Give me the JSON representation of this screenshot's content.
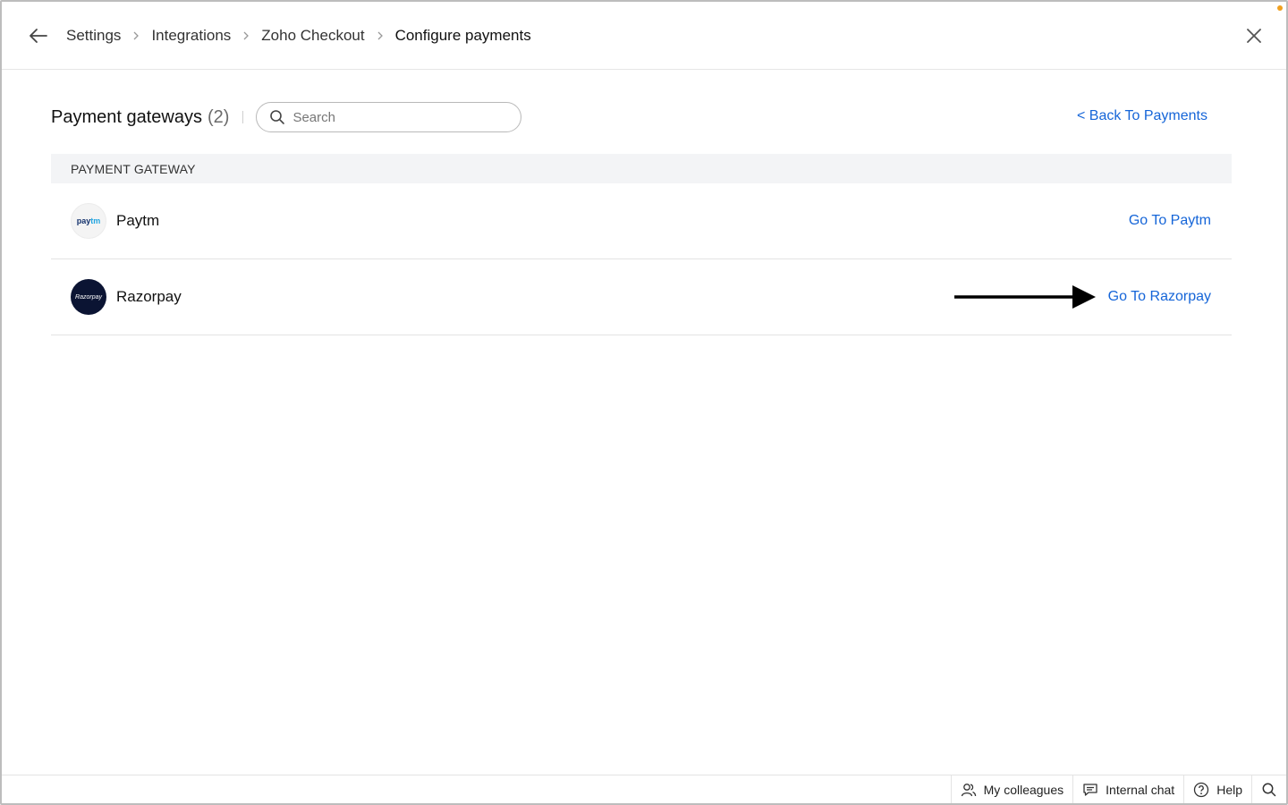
{
  "breadcrumb": [
    "Settings",
    "Integrations",
    "Zoho Checkout",
    "Configure payments"
  ],
  "title": {
    "label": "Payment gateways",
    "count": "(2)"
  },
  "search": {
    "placeholder": "Search",
    "value": ""
  },
  "back_link": "< Back To Payments",
  "table": {
    "column_header": "PAYMENT GATEWAY",
    "rows": [
      {
        "name": "Paytm",
        "logo_text_a": "pay",
        "logo_text_b": "tm",
        "action": "Go To Paytm"
      },
      {
        "name": "Razorpay",
        "logo_text": "Razorpay",
        "action": "Go To Razorpay"
      }
    ]
  },
  "footer": {
    "colleagues": "My colleagues",
    "chat": "Internal chat",
    "help": "Help"
  },
  "colors": {
    "link": "#1565d8",
    "table_header_bg": "#f3f4f6",
    "notif_dot": "#f0a020",
    "razorpay_logo_bg": "#0b1433"
  },
  "icons": [
    "back-arrow-icon",
    "chevron-right-icon",
    "close-icon",
    "search-icon",
    "people-icon",
    "chat-icon",
    "help-icon"
  ]
}
